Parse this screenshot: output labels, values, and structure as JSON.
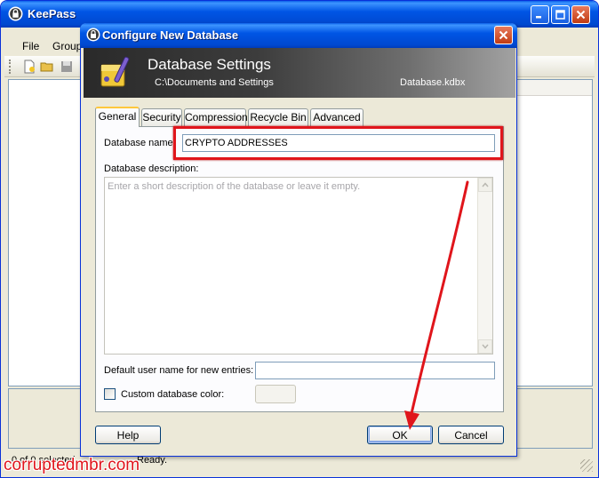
{
  "app": {
    "title": "KeePass",
    "menu": [
      "File",
      "Group"
    ],
    "status_left": "0 of 0 selected",
    "status_right": "Ready."
  },
  "dialog": {
    "title": "Configure New Database",
    "banner_title": "Database Settings",
    "banner_path": "C:\\Documents and Settings",
    "banner_file": "Database.kdbx",
    "tabs": [
      "General",
      "Security",
      "Compression",
      "Recycle Bin",
      "Advanced"
    ],
    "active_tab": "General",
    "fields": {
      "db_name_label": "Database name:",
      "db_name_value": "CRYPTO ADDRESSES",
      "db_desc_label": "Database description:",
      "db_desc_placeholder": "Enter a short description of the database or leave it empty.",
      "username_label": "Default user name for new entries:",
      "username_value": "",
      "custom_color_label": "Custom database color:",
      "custom_color_checked": false
    },
    "buttons": {
      "help": "Help",
      "ok": "OK",
      "cancel": "Cancel"
    }
  },
  "annotation": {
    "highlight_color": "#e0151b",
    "watermark": "corruptedmbr.com"
  },
  "colors": {
    "xp_titlebar": "#0055e5",
    "dialog_face": "#ece9d8",
    "accent_red": "#e0151b"
  }
}
